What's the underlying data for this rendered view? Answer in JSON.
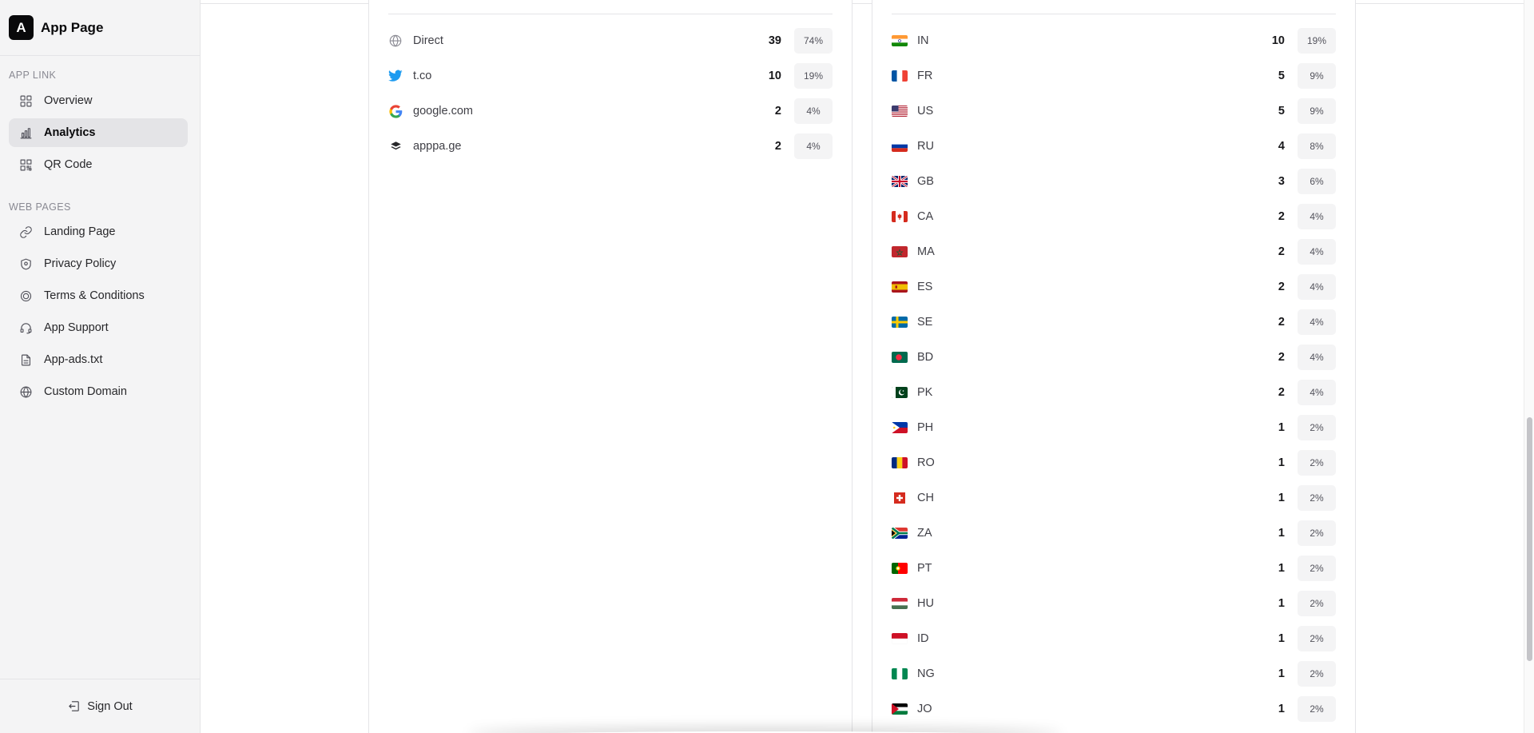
{
  "brand": {
    "logo_letter": "A",
    "name": "App Page"
  },
  "sidebar": {
    "app_link_label": "APP LINK",
    "app_link_items": [
      {
        "label": "Overview",
        "icon": "grid-icon",
        "active": false
      },
      {
        "label": "Analytics",
        "icon": "bar-chart-icon",
        "active": true
      },
      {
        "label": "QR Code",
        "icon": "qr-code-icon",
        "active": false
      }
    ],
    "web_pages_label": "WEB PAGES",
    "web_pages_items": [
      {
        "label": "Landing Page",
        "icon": "link-icon"
      },
      {
        "label": "Privacy Policy",
        "icon": "shield-icon"
      },
      {
        "label": "Terms & Conditions",
        "icon": "badge-icon"
      },
      {
        "label": "App Support",
        "icon": "headset-icon"
      },
      {
        "label": "App-ads.txt",
        "icon": "file-icon"
      },
      {
        "label": "Custom Domain",
        "icon": "globe-icon"
      }
    ],
    "sign_out_label": "Sign Out"
  },
  "referrers": [
    {
      "name": "Direct",
      "count": "39",
      "percent": "74%",
      "icon": "globe-icon"
    },
    {
      "name": "t.co",
      "count": "10",
      "percent": "19%",
      "icon": "twitter-icon"
    },
    {
      "name": "google.com",
      "count": "2",
      "percent": "4%",
      "icon": "google-icon"
    },
    {
      "name": "apppa.ge",
      "count": "2",
      "percent": "4%",
      "icon": "apppage-logo-icon"
    }
  ],
  "countries": [
    {
      "code": "IN",
      "count": "10",
      "percent": "19%"
    },
    {
      "code": "FR",
      "count": "5",
      "percent": "9%"
    },
    {
      "code": "US",
      "count": "5",
      "percent": "9%"
    },
    {
      "code": "RU",
      "count": "4",
      "percent": "8%"
    },
    {
      "code": "GB",
      "count": "3",
      "percent": "6%"
    },
    {
      "code": "CA",
      "count": "2",
      "percent": "4%"
    },
    {
      "code": "MA",
      "count": "2",
      "percent": "4%"
    },
    {
      "code": "ES",
      "count": "2",
      "percent": "4%"
    },
    {
      "code": "SE",
      "count": "2",
      "percent": "4%"
    },
    {
      "code": "BD",
      "count": "2",
      "percent": "4%"
    },
    {
      "code": "PK",
      "count": "2",
      "percent": "4%"
    },
    {
      "code": "PH",
      "count": "1",
      "percent": "2%"
    },
    {
      "code": "RO",
      "count": "1",
      "percent": "2%"
    },
    {
      "code": "CH",
      "count": "1",
      "percent": "2%"
    },
    {
      "code": "ZA",
      "count": "1",
      "percent": "2%"
    },
    {
      "code": "PT",
      "count": "1",
      "percent": "2%"
    },
    {
      "code": "HU",
      "count": "1",
      "percent": "2%"
    },
    {
      "code": "ID",
      "count": "1",
      "percent": "2%"
    },
    {
      "code": "NG",
      "count": "1",
      "percent": "2%"
    },
    {
      "code": "JO",
      "count": "1",
      "percent": "2%"
    }
  ]
}
